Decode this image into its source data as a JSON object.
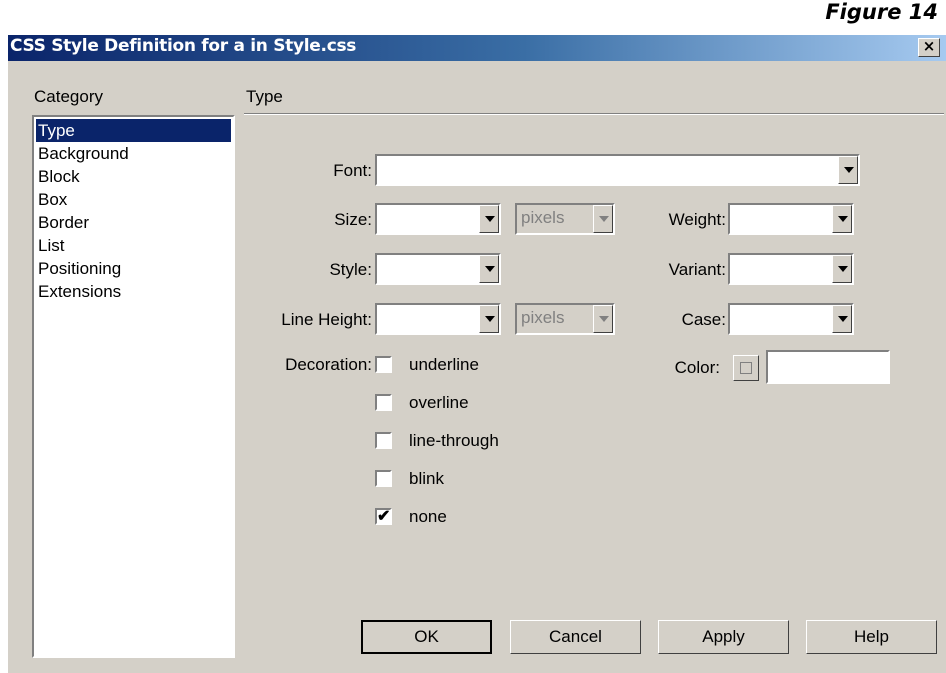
{
  "figure_label": "Figure 14",
  "window": {
    "title": "CSS Style Definition for a in Style.css",
    "close_glyph": "×"
  },
  "category": {
    "label": "Category",
    "items": [
      "Type",
      "Background",
      "Block",
      "Box",
      "Border",
      "List",
      "Positioning",
      "Extensions"
    ],
    "selected": "Type"
  },
  "panel": {
    "title": "Type",
    "font_label": "Font:",
    "font_value": "",
    "size_label": "Size:",
    "size_value": "",
    "size_unit": "pixels",
    "weight_label": "Weight:",
    "weight_value": "",
    "style_label": "Style:",
    "style_value": "",
    "variant_label": "Variant:",
    "variant_value": "",
    "line_height_label": "Line Height:",
    "line_height_value": "",
    "line_height_unit": "pixels",
    "case_label": "Case:",
    "case_value": "",
    "color_label": "Color:",
    "color_value": "",
    "decoration_label": "Decoration:",
    "decorations": [
      {
        "label": "underline",
        "checked": false
      },
      {
        "label": "overline",
        "checked": false
      },
      {
        "label": "line-through",
        "checked": false
      },
      {
        "label": "blink",
        "checked": false
      },
      {
        "label": "none",
        "checked": true
      }
    ],
    "check_glyph": "✔"
  },
  "buttons": {
    "ok": "OK",
    "cancel": "Cancel",
    "apply": "Apply",
    "help": "Help"
  }
}
